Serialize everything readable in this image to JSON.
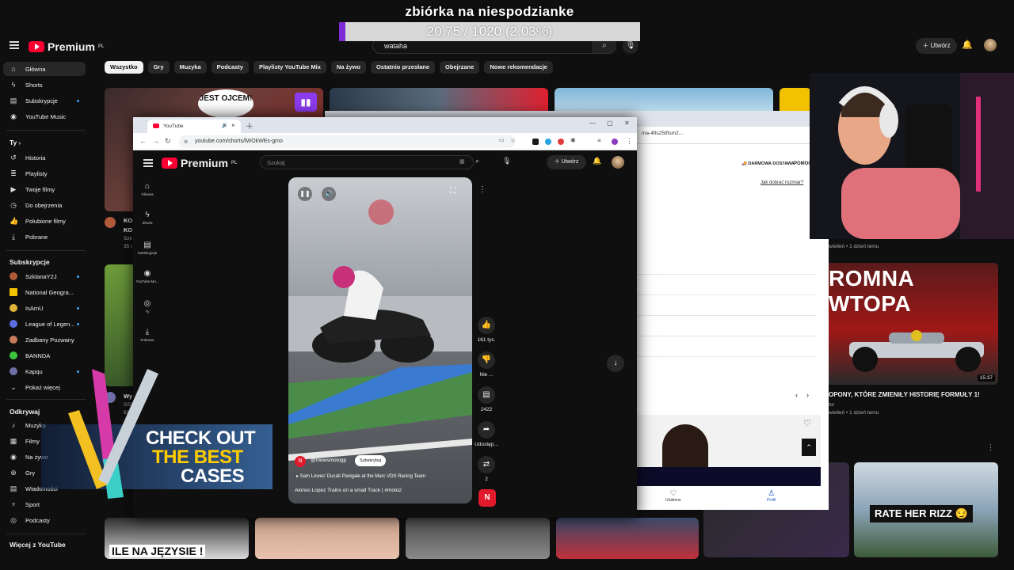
{
  "donation": {
    "title": "zbiórka na niespodzianke",
    "progress_text": "20.75 / 1020 (2.03%)",
    "raised": 20.75,
    "goal": 1020,
    "percent": 2.03,
    "fill_color": "#7d2bd6"
  },
  "youtube": {
    "logo_text": "Premium",
    "logo_sup": "PL",
    "search_value": "wataha",
    "create_label": "Utwórz",
    "chips": [
      "Wszystko",
      "Gry",
      "Muzyka",
      "Podcasty",
      "Playlisty YouTube Mix",
      "Na żywo",
      "Ostatnio przesłane",
      "Obejrzane",
      "Nowe rekomendacje"
    ],
    "sidebar": {
      "main": [
        "Główna",
        "Shorts",
        "Subskrypcje",
        "YouTube Music"
      ],
      "you_heading": "Ty",
      "you_items": [
        "Historia",
        "Playlisty",
        "Twoje filmy",
        "Do obejrzenia",
        "Polubione filmy",
        "Pobrane"
      ],
      "subs_heading": "Subskrypcje",
      "subs": [
        "SzklanaY2J",
        "National Geogra...",
        "IsAmU",
        "League of Legen...",
        "Zadbany Pozwany",
        "BANNDA",
        "Kapqu"
      ],
      "show_more": "Pokaż więcej",
      "explore_heading": "Odkrywaj",
      "explore": [
        "Muzyka",
        "Filmy",
        "Na żywo",
        "Gry",
        "Wiadomości",
        "Sport",
        "Podcasty"
      ],
      "more_heading": "Więcej z YouTube"
    },
    "feed": {
      "thumb_text": "JEST OJCEM!",
      "video_title": "OPONY, KTÓRE ZMIENIŁY HISTORIĘ FORMUŁY 1!",
      "video_meta_1": "wietleń • 1 dzień temu",
      "video_meta_2": "wietleń • 1 dzień temu",
      "video_meta_author": "tor",
      "f1_banner": "ROMNA WTOPA",
      "f1_duration": "15:37",
      "rate_banner": "RATE HER RIZZ 😏",
      "bottom_left_banner": "ILE NA JĘZYSIE !",
      "partial_title_1": "KO",
      "partial_title_2": "KO",
      "partial_meta_1": "Szk",
      "partial_meta_2": "35 t",
      "partial_title_3": "Wy",
      "partial_meta_3": "GSX",
      "partial_meta_4": "83"
    }
  },
  "overlay_ad": {
    "line1": "CHECK OUT",
    "line2": "THE BEST",
    "line3": "CASES"
  },
  "chrome": {
    "tab_title": "YouTube",
    "url": "youtube.com/shorts/lWOkWEs-gmo",
    "inner_search_placeholder": "Szukaj",
    "inner_create": "Utwórz",
    "mini_sidebar": [
      "Główna",
      "Shorts",
      "Subskrypcje",
      "YouTube Mu...",
      "Ty",
      "Pobrane"
    ],
    "short": {
      "channel": "@mewsmotogp",
      "subscribe": "Subskrybuj",
      "related": "Sam Lowes' Ducati Panigale at the Marc VDS Racing Team",
      "title": "Alonso Lopez Trains on a small Track | #moto2",
      "likes": "161 tys.",
      "dislike": "Nie ...",
      "comments": "2422",
      "share": "Udostęp...",
      "remix": "2"
    }
  },
  "shop_window": {
    "url_partial": "ma-4fts25tftsm2...",
    "delivery": "DARMOWA DOSTAWA",
    "help": "POMOC",
    "size_link": "Jak dobrać rozmiar?",
    "fav_label": "Ulubione",
    "profile_label": "Profil"
  }
}
